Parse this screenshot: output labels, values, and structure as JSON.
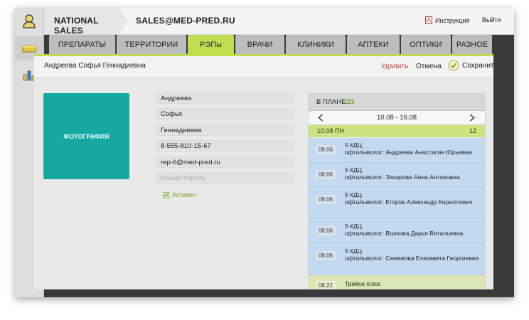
{
  "topbar": {
    "section": "NATIONAL SALES",
    "email": "SALES@MED-PRED.RU",
    "help_label": "Инструкция",
    "logout_label": "Выйти"
  },
  "tabs": [
    "ПРЕПАРАТЫ",
    "ТЕРРИТОРИИ",
    "РЭПы",
    "ВРАЧИ",
    "КЛИНИКИ",
    "АПТЕКИ",
    "ОПТИКИ",
    "РАЗНОЕ"
  ],
  "active_tab": "РЭПы",
  "record": {
    "full_name": "Андреева Софья Геннадиевна",
    "delete_label": "Удалить",
    "cancel_label": "Отмена",
    "save_label": "Сохранить",
    "photo_label": "ФОТОГРАФИЯ",
    "fields": {
      "last_name": "Андреева",
      "first_name": "Софья",
      "middle_name": "Геннадиевна",
      "phone": "8-555-810-15-67",
      "email": "rep-6@med-pred.ru",
      "password_placeholder": "Новый пароль"
    },
    "active_label": "Активен",
    "active_checked": true
  },
  "plan": {
    "label": "В ПЛАНЕ:",
    "count": "23",
    "week": "10.08 - 16.08",
    "day_label": "10.08 ПН",
    "day_count": "12",
    "appointments": [
      {
        "time": "08:06",
        "title": "5 КДЦ",
        "detail": "офтальмолог: Андреева Анастасия Юрьевна"
      },
      {
        "time": "08:06",
        "title": "5 КДЦ",
        "detail": "офтальмолог: Захарова Анна Антоновна"
      },
      {
        "time": "08:06",
        "title": "5 КДЦ",
        "detail": "офтальмолог: Егоров Александр Кириллович"
      },
      {
        "time": "08:06",
        "title": "5 КДЦ",
        "detail": "офтальмолог: Волкова Дарья Витальевна"
      },
      {
        "time": "08:06",
        "title": "5 КДЦ",
        "detail": "офтальмолог: Семенова Елизавета Георгиевна"
      },
      {
        "time": "08:22",
        "title": "Трейси плюс",
        "detail": ""
      }
    ]
  },
  "colors": {
    "accent_green": "#c2dd4f",
    "photo_teal": "#17a8a2",
    "delete_red": "#c0392b",
    "appointment_blue": "#c3d9ef"
  },
  "icons": {
    "rail": [
      "user-icon",
      "drawer-icon",
      "bar-chart-icon"
    ],
    "help": "pdf-icon",
    "save": "check-icon",
    "prev": "chevron-left-icon",
    "next": "chevron-right-icon"
  }
}
